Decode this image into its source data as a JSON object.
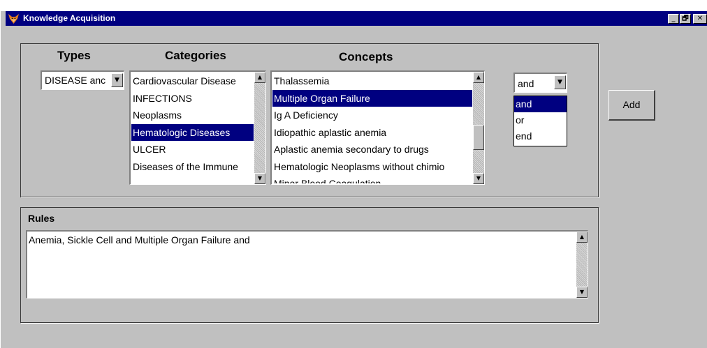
{
  "window": {
    "title": "Knowledge Acquisition",
    "app_icon": "fox-app-icon",
    "minimize_glyph": "_",
    "maximize_glyph": "🗗",
    "close_glyph": "✕"
  },
  "query": {
    "types_header": "Types",
    "categories_header": "Categories",
    "concepts_header": "Concepts",
    "types_select": {
      "value": "DISEASE anc"
    },
    "categories": {
      "items": [
        "Cardiovascular Disease",
        "INFECTIONS",
        "Neoplasms",
        "Hematologic Diseases",
        "ULCER",
        "Diseases of the Immune"
      ],
      "selected": "Hematologic Diseases"
    },
    "concepts": {
      "items": [
        "Thalassemia",
        "Multiple Organ Failure",
        "Ig A Deficiency",
        "Idiopathic aplastic anemia",
        "Aplastic anemia  secondary to drugs",
        "Hematologic Neoplasms without chimio",
        "Minor Blood Coagulation"
      ],
      "selected": "Multiple Organ Failure"
    },
    "operator": {
      "value": "and",
      "options": [
        "and",
        "or",
        "end"
      ],
      "highlighted": "and"
    },
    "add_label": "Add"
  },
  "rules": {
    "label": "Rules",
    "text": "Anemia, Sickle Cell  and  Multiple Organ Failure  and"
  },
  "colors": {
    "titlebar": "#000080",
    "face": "#c0c0c0",
    "selection": "#000080"
  }
}
